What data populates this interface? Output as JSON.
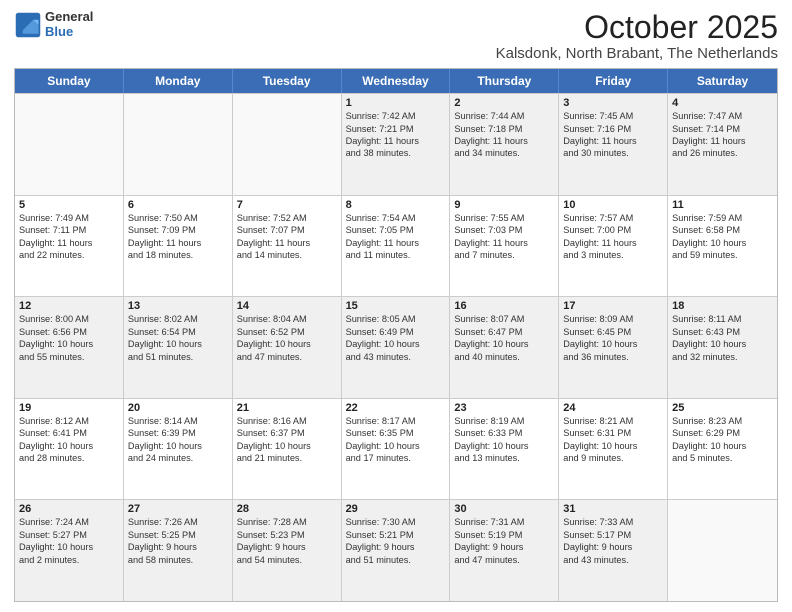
{
  "logo": {
    "general": "General",
    "blue": "Blue"
  },
  "title": "October 2025",
  "subtitle": "Kalsdonk, North Brabant, The Netherlands",
  "weekdays": [
    "Sunday",
    "Monday",
    "Tuesday",
    "Wednesday",
    "Thursday",
    "Friday",
    "Saturday"
  ],
  "weeks": [
    [
      {
        "day": "",
        "lines": [],
        "empty": true
      },
      {
        "day": "",
        "lines": [],
        "empty": true
      },
      {
        "day": "",
        "lines": [],
        "empty": true
      },
      {
        "day": "1",
        "lines": [
          "Sunrise: 7:42 AM",
          "Sunset: 7:21 PM",
          "Daylight: 11 hours",
          "and 38 minutes."
        ]
      },
      {
        "day": "2",
        "lines": [
          "Sunrise: 7:44 AM",
          "Sunset: 7:18 PM",
          "Daylight: 11 hours",
          "and 34 minutes."
        ]
      },
      {
        "day": "3",
        "lines": [
          "Sunrise: 7:45 AM",
          "Sunset: 7:16 PM",
          "Daylight: 11 hours",
          "and 30 minutes."
        ]
      },
      {
        "day": "4",
        "lines": [
          "Sunrise: 7:47 AM",
          "Sunset: 7:14 PM",
          "Daylight: 11 hours",
          "and 26 minutes."
        ]
      }
    ],
    [
      {
        "day": "5",
        "lines": [
          "Sunrise: 7:49 AM",
          "Sunset: 7:11 PM",
          "Daylight: 11 hours",
          "and 22 minutes."
        ]
      },
      {
        "day": "6",
        "lines": [
          "Sunrise: 7:50 AM",
          "Sunset: 7:09 PM",
          "Daylight: 11 hours",
          "and 18 minutes."
        ]
      },
      {
        "day": "7",
        "lines": [
          "Sunrise: 7:52 AM",
          "Sunset: 7:07 PM",
          "Daylight: 11 hours",
          "and 14 minutes."
        ]
      },
      {
        "day": "8",
        "lines": [
          "Sunrise: 7:54 AM",
          "Sunset: 7:05 PM",
          "Daylight: 11 hours",
          "and 11 minutes."
        ]
      },
      {
        "day": "9",
        "lines": [
          "Sunrise: 7:55 AM",
          "Sunset: 7:03 PM",
          "Daylight: 11 hours",
          "and 7 minutes."
        ]
      },
      {
        "day": "10",
        "lines": [
          "Sunrise: 7:57 AM",
          "Sunset: 7:00 PM",
          "Daylight: 11 hours",
          "and 3 minutes."
        ]
      },
      {
        "day": "11",
        "lines": [
          "Sunrise: 7:59 AM",
          "Sunset: 6:58 PM",
          "Daylight: 10 hours",
          "and 59 minutes."
        ]
      }
    ],
    [
      {
        "day": "12",
        "lines": [
          "Sunrise: 8:00 AM",
          "Sunset: 6:56 PM",
          "Daylight: 10 hours",
          "and 55 minutes."
        ]
      },
      {
        "day": "13",
        "lines": [
          "Sunrise: 8:02 AM",
          "Sunset: 6:54 PM",
          "Daylight: 10 hours",
          "and 51 minutes."
        ]
      },
      {
        "day": "14",
        "lines": [
          "Sunrise: 8:04 AM",
          "Sunset: 6:52 PM",
          "Daylight: 10 hours",
          "and 47 minutes."
        ]
      },
      {
        "day": "15",
        "lines": [
          "Sunrise: 8:05 AM",
          "Sunset: 6:49 PM",
          "Daylight: 10 hours",
          "and 43 minutes."
        ]
      },
      {
        "day": "16",
        "lines": [
          "Sunrise: 8:07 AM",
          "Sunset: 6:47 PM",
          "Daylight: 10 hours",
          "and 40 minutes."
        ]
      },
      {
        "day": "17",
        "lines": [
          "Sunrise: 8:09 AM",
          "Sunset: 6:45 PM",
          "Daylight: 10 hours",
          "and 36 minutes."
        ]
      },
      {
        "day": "18",
        "lines": [
          "Sunrise: 8:11 AM",
          "Sunset: 6:43 PM",
          "Daylight: 10 hours",
          "and 32 minutes."
        ]
      }
    ],
    [
      {
        "day": "19",
        "lines": [
          "Sunrise: 8:12 AM",
          "Sunset: 6:41 PM",
          "Daylight: 10 hours",
          "and 28 minutes."
        ]
      },
      {
        "day": "20",
        "lines": [
          "Sunrise: 8:14 AM",
          "Sunset: 6:39 PM",
          "Daylight: 10 hours",
          "and 24 minutes."
        ]
      },
      {
        "day": "21",
        "lines": [
          "Sunrise: 8:16 AM",
          "Sunset: 6:37 PM",
          "Daylight: 10 hours",
          "and 21 minutes."
        ]
      },
      {
        "day": "22",
        "lines": [
          "Sunrise: 8:17 AM",
          "Sunset: 6:35 PM",
          "Daylight: 10 hours",
          "and 17 minutes."
        ]
      },
      {
        "day": "23",
        "lines": [
          "Sunrise: 8:19 AM",
          "Sunset: 6:33 PM",
          "Daylight: 10 hours",
          "and 13 minutes."
        ]
      },
      {
        "day": "24",
        "lines": [
          "Sunrise: 8:21 AM",
          "Sunset: 6:31 PM",
          "Daylight: 10 hours",
          "and 9 minutes."
        ]
      },
      {
        "day": "25",
        "lines": [
          "Sunrise: 8:23 AM",
          "Sunset: 6:29 PM",
          "Daylight: 10 hours",
          "and 5 minutes."
        ]
      }
    ],
    [
      {
        "day": "26",
        "lines": [
          "Sunrise: 7:24 AM",
          "Sunset: 5:27 PM",
          "Daylight: 10 hours",
          "and 2 minutes."
        ]
      },
      {
        "day": "27",
        "lines": [
          "Sunrise: 7:26 AM",
          "Sunset: 5:25 PM",
          "Daylight: 9 hours",
          "and 58 minutes."
        ]
      },
      {
        "day": "28",
        "lines": [
          "Sunrise: 7:28 AM",
          "Sunset: 5:23 PM",
          "Daylight: 9 hours",
          "and 54 minutes."
        ]
      },
      {
        "day": "29",
        "lines": [
          "Sunrise: 7:30 AM",
          "Sunset: 5:21 PM",
          "Daylight: 9 hours",
          "and 51 minutes."
        ]
      },
      {
        "day": "30",
        "lines": [
          "Sunrise: 7:31 AM",
          "Sunset: 5:19 PM",
          "Daylight: 9 hours",
          "and 47 minutes."
        ]
      },
      {
        "day": "31",
        "lines": [
          "Sunrise: 7:33 AM",
          "Sunset: 5:17 PM",
          "Daylight: 9 hours",
          "and 43 minutes."
        ]
      },
      {
        "day": "",
        "lines": [],
        "empty": true
      }
    ]
  ]
}
